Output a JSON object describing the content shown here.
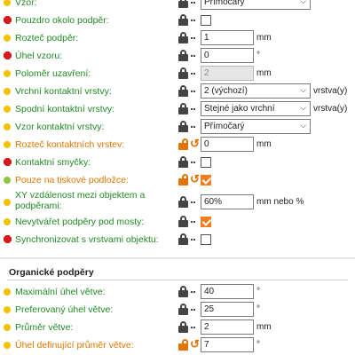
{
  "rows": [
    {
      "label": "Vzor:",
      "dot": "yellow",
      "color": "green",
      "value": "Přímočarý"
    },
    {
      "label": "Pouzdro okolo podpěr:",
      "dot": "red",
      "color": "green"
    },
    {
      "label": "Rozteč podpěr:",
      "dot": "yellow",
      "color": "green",
      "value": "1",
      "unit": "mm"
    },
    {
      "label": "Úhel vzoru:",
      "dot": "red",
      "color": "green",
      "value": "0",
      "unit": "°"
    },
    {
      "label": "Poloměr uzavření:",
      "dot": "yellow",
      "color": "green",
      "value": "2",
      "unit": "mm"
    },
    {
      "label": "Vrchní kontaktní vrstvy:",
      "dot": "yellow",
      "color": "green",
      "value": "2 (výchozí)",
      "unit": "vrstva(y)"
    },
    {
      "label": "Spodní kontaktní vrstvy:",
      "dot": "yellow",
      "color": "green",
      "value": "Stejné jako vrchní",
      "unit": "vrstva(y)"
    },
    {
      "label": "Vzor kontaktní vrstvy:",
      "dot": "yellow",
      "color": "green",
      "value": "Přímočarý"
    },
    {
      "label": "Rozteč kontaktních vrstev:",
      "dot": "yellow",
      "color": "orange",
      "value": "0",
      "unit": "mm"
    },
    {
      "label": "Kontaktní smyčky:",
      "dot": "red",
      "color": "green"
    },
    {
      "label": "Pouze na tiskové podložce:",
      "dot": "green",
      "color": "orange"
    },
    {
      "label": "XY vzdálenost mezi objektem a podpěrami:",
      "dot": "yellow",
      "color": "green",
      "value": "60%",
      "unit": "mm nebo %"
    },
    {
      "label": "Nevytvářet podpěry pod mosty:",
      "dot": "yellow",
      "color": "green"
    },
    {
      "label": "Synchronizovat s vrstvami objektu:",
      "dot": "red",
      "color": "green"
    }
  ],
  "organic": {
    "title": "Organické podpěry",
    "rows": [
      {
        "label": "Maximální úhel větve:",
        "value": "40",
        "unit": "°"
      },
      {
        "label": "Preferovaný úhel větve:",
        "value": "25",
        "unit": "°"
      },
      {
        "label": "Průměr větve:",
        "value": "2",
        "unit": "mm"
      },
      {
        "label": "Úhel definující průměr větve:",
        "value": "7",
        "unit": "°"
      }
    ]
  },
  "colors": {
    "green_label": "#1f8a22",
    "orange_label": "#e07400",
    "checked": "#f07d1e"
  }
}
